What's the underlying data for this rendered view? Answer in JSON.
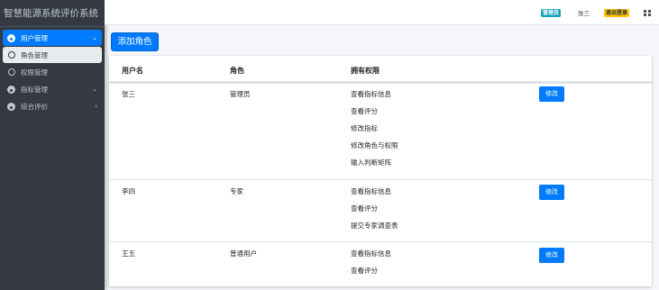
{
  "app": {
    "title": "智慧能源系统评价系统"
  },
  "sidebar": {
    "items": [
      {
        "label": "用户管理",
        "icon": "gauge-icon",
        "caret": "⌄"
      },
      {
        "label": "角色管理",
        "icon": "circle-icon"
      },
      {
        "label": "权限管理",
        "icon": "circle-icon"
      },
      {
        "label": "指标管理",
        "icon": "gauge-icon",
        "caret": "⌄"
      },
      {
        "label": "综合评价",
        "icon": "gauge-icon",
        "caret": "‹"
      }
    ]
  },
  "topbar": {
    "role_badge": "管理员",
    "username": "张三",
    "logout_label": "退出登录",
    "apps_icon": "grid-icon"
  },
  "main": {
    "add_role_label": "添加角色",
    "table": {
      "headers": [
        "用户名",
        "角色",
        "拥有权限"
      ],
      "rows": [
        {
          "username": "张三",
          "role": "管理员",
          "permissions": [
            "查看指标信息",
            "查看评分",
            "修改指标",
            "修改角色与权限",
            "输入判断矩阵"
          ],
          "action": "修改"
        },
        {
          "username": "李四",
          "role": "专家",
          "permissions": [
            "查看指标信息",
            "查看评分",
            "提交专家调查表"
          ],
          "action": "修改"
        },
        {
          "username": "王五",
          "role": "普通用户",
          "permissions": [
            "查看指标信息",
            "查看评分"
          ],
          "action": "修改"
        }
      ]
    }
  },
  "colors": {
    "primary": "#007bff",
    "sidebar": "#343a40",
    "info": "#17a2b8",
    "warning": "#ffc107"
  }
}
